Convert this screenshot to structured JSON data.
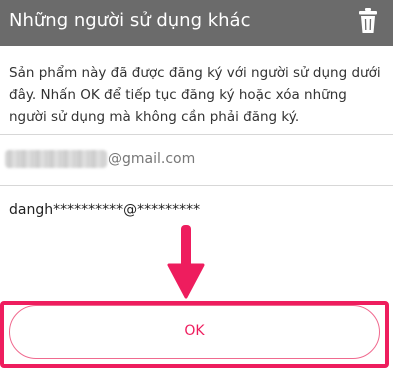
{
  "header": {
    "title": "Những người sử dụng khác",
    "trash_icon": "trash-icon"
  },
  "description": "Sản phẩm này đã được đăng ký với người sử dụng dưới đây. Nhấn OK để tiếp tục đăng ký hoặc xóa những người sử dụng mà không cần phải đăng ký.",
  "users": [
    {
      "email_domain": "@gmail.com",
      "local_part_blurred": true
    },
    {
      "email": "dangh**********@*********"
    }
  ],
  "annotation": {
    "arrow_icon": "arrow-down-icon",
    "highlight_color": "#ee1d5e"
  },
  "ok_button": {
    "label": "OK"
  },
  "colors": {
    "header_bg": "#6b6b6b",
    "accent": "#ee1d5e",
    "divider": "#d7d7d7"
  }
}
